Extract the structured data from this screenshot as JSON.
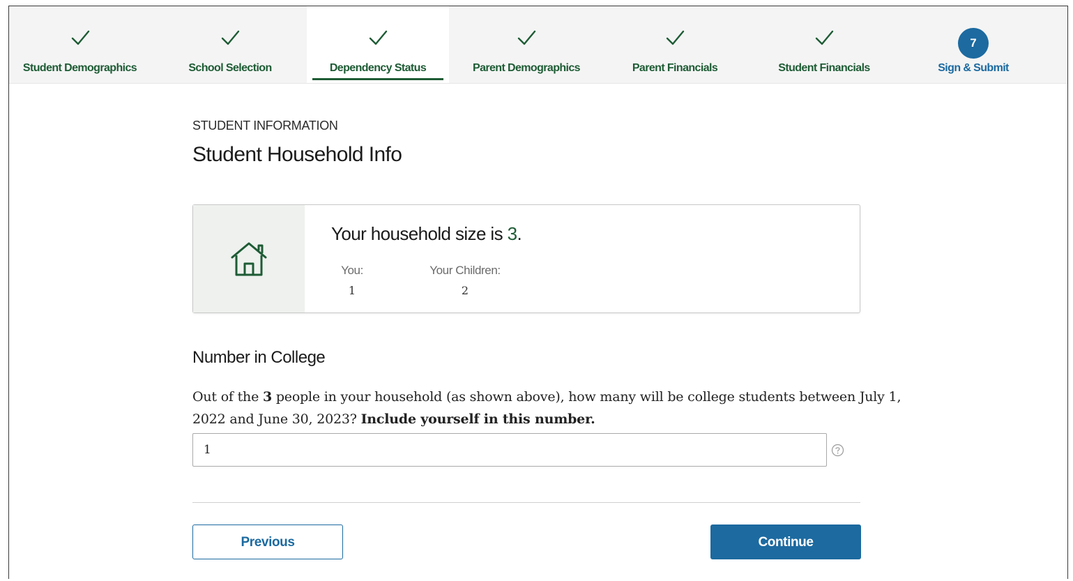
{
  "stepper": {
    "steps": [
      {
        "label": "Student Demographics",
        "status": "complete"
      },
      {
        "label": "School Selection",
        "status": "complete"
      },
      {
        "label": "Dependency Status",
        "status": "complete-current"
      },
      {
        "label": "Parent Demographics",
        "status": "complete"
      },
      {
        "label": "Parent Financials",
        "status": "complete"
      },
      {
        "label": "Student Financials",
        "status": "complete"
      },
      {
        "label": "Sign & Submit",
        "status": "pending",
        "number": "7"
      }
    ]
  },
  "page": {
    "eyebrow": "STUDENT INFORMATION",
    "title": "Student Household Info"
  },
  "household": {
    "heading_prefix": "Your household size is ",
    "size": "3",
    "heading_suffix": ".",
    "you_label": "You:",
    "you_value": "1",
    "children_label": "Your Children:",
    "children_value": "2"
  },
  "number_in_college": {
    "title": "Number in College",
    "q_part1": "Out of the ",
    "q_count": "3",
    "q_part2": " people in your household (as shown above), how many will be college students between July 1, 2022 and June 30, 2023? ",
    "q_emphasis": "Include yourself in this number.",
    "value": "1",
    "help_icon": "question-circle-icon"
  },
  "actions": {
    "previous_label": "Previous",
    "continue_label": "Continue"
  },
  "colors": {
    "green": "#1e5c35",
    "blue": "#1c6aa0"
  }
}
